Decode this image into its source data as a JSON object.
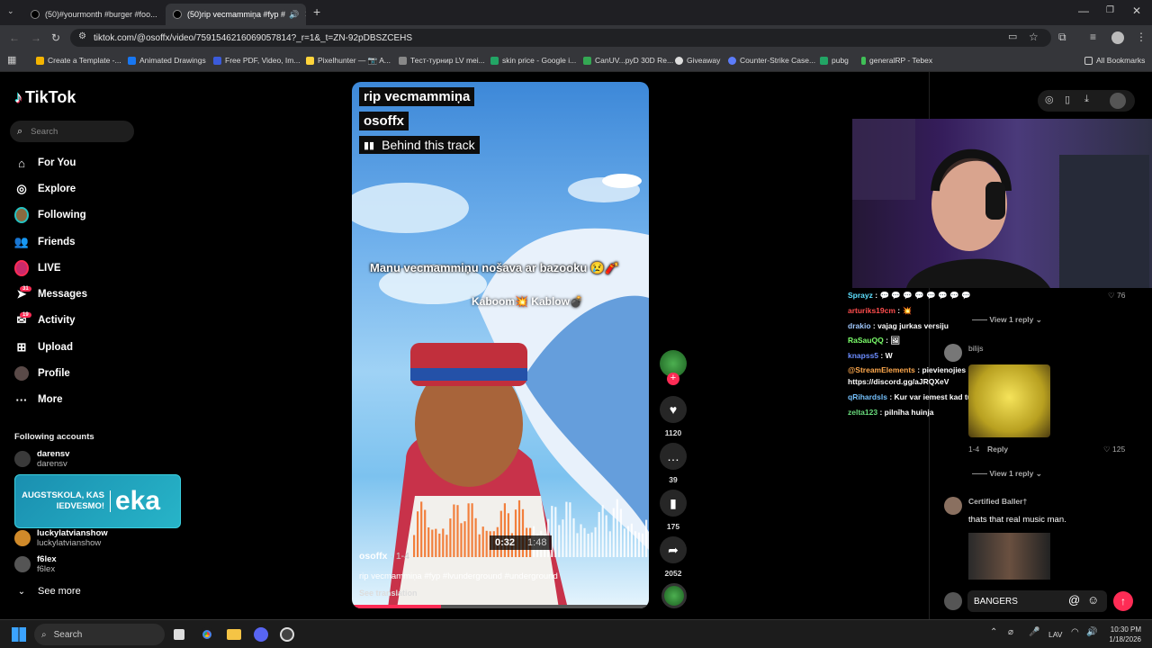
{
  "browser": {
    "tabs": [
      {
        "title": "(50)#yourmonth #burger #foo..."
      },
      {
        "title": "(50)rip vecmammiņa #fyp #"
      }
    ],
    "new_tab": "+",
    "url": "tiktok.com/@osoffx/video/7591546216069057814?_r=1&_t=ZN-92pDBSZCEHS",
    "bookmarks": [
      {
        "label": "Create a Template -...",
        "color": "#f4b400"
      },
      {
        "label": "Animated Drawings",
        "color": "#1877f2"
      },
      {
        "label": "Free PDF, Video, Im...",
        "color": "#3b5bdb"
      },
      {
        "label": "Pixelhunter — 📷 A...",
        "color": "#ffd43b"
      },
      {
        "label": "Тест-турнир LV mei...",
        "color": "#888888"
      },
      {
        "label": "skin price - Google i...",
        "color": "#22a565"
      },
      {
        "label": "CanUV...pyD 30D Re...",
        "color": "#34a853"
      },
      {
        "label": "Giveaway",
        "color": "#dddddd"
      },
      {
        "label": "Counter-Strike Case...",
        "color": "#5c7cfa"
      },
      {
        "label": "pubg",
        "color": "#22a565"
      },
      {
        "label": "generalRP - Tebex",
        "color": "#40c057"
      }
    ],
    "all_bookmarks": "All Bookmarks"
  },
  "sidebar": {
    "logo": "TikTok",
    "search_placeholder": "Search",
    "nav": [
      {
        "label": "For You",
        "icon": "home-icon"
      },
      {
        "label": "Explore",
        "icon": "compass-icon"
      },
      {
        "label": "Following",
        "icon": "following-avatar-icon"
      },
      {
        "label": "Friends",
        "icon": "friends-icon"
      },
      {
        "label": "LIVE",
        "icon": "live-icon"
      },
      {
        "label": "Messages",
        "icon": "messages-icon",
        "badge": "31"
      },
      {
        "label": "Activity",
        "icon": "activity-icon",
        "badge": "19"
      },
      {
        "label": "Upload",
        "icon": "upload-icon"
      },
      {
        "label": "Profile",
        "icon": "profile-avatar-icon"
      },
      {
        "label": "More",
        "icon": "more-icon"
      }
    ],
    "following_heading": "Following accounts",
    "accounts": [
      {
        "name": "darensv",
        "handle": "darensv"
      },
      {
        "name": "luckylatvianshow",
        "handle": "luckylatvianshow"
      },
      {
        "name": "f6lex",
        "handle": "f6lex"
      }
    ],
    "see_more": "See more",
    "overlay_text": "AUGSTSKOLA, KAS IEDVESMO!",
    "overlay_brand": "eka"
  },
  "video": {
    "title_chip": "rip vecmammiņa",
    "author_chip": "osoffx",
    "track_chip": "Behind this track",
    "caption1": "Manu vecmammiņu nošava ar bazooku 😢🧨",
    "caption2": "Kaboom💥 Kablow💣",
    "time_current": "0:32",
    "time_total": "1:48",
    "progress": 0.3,
    "author": "osoffx",
    "date": "1-4",
    "description": "rip vecmammiņa #fyp #lvunderground #underground",
    "see_translation": "See translation"
  },
  "actions": {
    "likes": "1120",
    "comments": "39",
    "saves": "175",
    "shares": "2052"
  },
  "chat": [
    {
      "user": "Sprayz",
      "text": ": 💬 💬 💬 💬 💬 💬 💬 💬",
      "color": "#5ee0ff"
    },
    {
      "user": "arturiks19cm",
      "text": ": 💥",
      "color": "#ff4d4d"
    },
    {
      "user": "drakio",
      "text": ": vajag jurkas versiju",
      "color": "#a0c8ff"
    },
    {
      "user": "RaSauQQ",
      "text": ": 🖼",
      "color": "#7cff6b"
    },
    {
      "user": "knapss5",
      "text": ": W",
      "color": "#6b8cff"
    },
    {
      "user": "@StreamElements",
      "text": ": pievienojies manam Discordam!",
      "color": "#ffa94d"
    },
    {
      "user": "",
      "text": "https://discord.gg/aJRQXeV",
      "color": "#ffffff"
    },
    {
      "user": "qRihardsls",
      "text": ": Kur var iemest kad tu vari noskatīties? 😂",
      "color": "#74c0fc"
    },
    {
      "user": "zelta123",
      "text": ": pilnīha huinja",
      "color": "#69db7c"
    }
  ],
  "comments": {
    "top_like": "76",
    "view_reply_1": "View 1 reply",
    "reply_user": "bilijs",
    "reply_date": "1-4",
    "reply_label": "Reply",
    "reply_likes": "125",
    "view_reply_2": "View 1 reply",
    "c2_user": "Certified Baller†",
    "c2_text": "thats that real music man.",
    "input_value": "BANGERS"
  },
  "taskbar": {
    "search_placeholder": "Search",
    "lang": "LAV",
    "time": "10:30 PM",
    "date": "1/18/2026"
  }
}
